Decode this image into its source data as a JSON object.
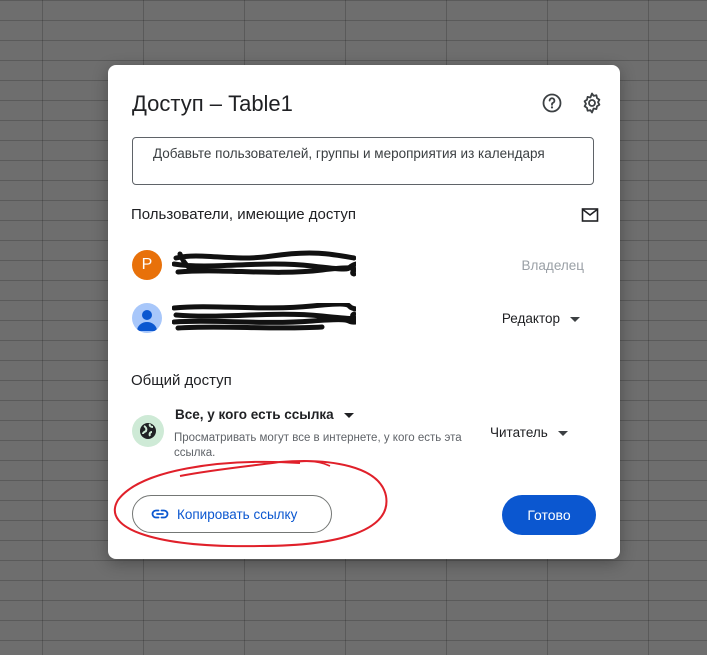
{
  "dialog": {
    "title": "Доступ – Table1",
    "help_icon": "help-circle-icon",
    "settings_icon": "gear-icon"
  },
  "add_people": {
    "placeholder": "Добавьте пользователей, группы и мероприятия из календаря"
  },
  "people_section": {
    "title": "Пользователи, имеющие доступ",
    "mail_icon": "mail-icon",
    "people": [
      {
        "avatar_letter": "P",
        "role": "Владелец",
        "avatar_color": "#e8710a"
      },
      {
        "avatar_letter": "",
        "role": "Редактор",
        "avatar_color": "#a8c7fa"
      }
    ]
  },
  "general_access": {
    "title": "Общий доступ",
    "scope_label": "Все, у кого есть ссылка",
    "description": "Просматривать могут все в интернете, у кого есть эта ссылка.",
    "role": "Читатель",
    "globe_icon": "globe-icon"
  },
  "actions": {
    "copy_link": "Копировать ссылку",
    "done": "Готово"
  },
  "colors": {
    "accent": "#0b57d0",
    "annotation": "#e0202a"
  }
}
